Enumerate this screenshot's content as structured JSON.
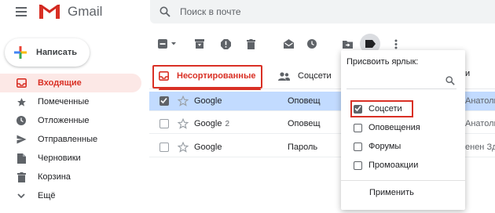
{
  "app": {
    "logo_text": "Gmail"
  },
  "search": {
    "placeholder": "Поиск в почте"
  },
  "compose": {
    "label": "Написать"
  },
  "sidebar": {
    "items": [
      {
        "label": "Входящие",
        "icon": "inbox-icon",
        "active": true
      },
      {
        "label": "Помеченные",
        "icon": "star-icon"
      },
      {
        "label": "Отложенные",
        "icon": "clock-icon"
      },
      {
        "label": "Отправленные",
        "icon": "send-icon"
      },
      {
        "label": "Черновики",
        "icon": "draft-icon"
      },
      {
        "label": "Корзина",
        "icon": "trash-icon"
      },
      {
        "label": "Ещё",
        "icon": "chevron-down-icon"
      }
    ]
  },
  "tabs": [
    {
      "label": "Несортированные",
      "icon": "inbox-icon"
    },
    {
      "label": "Соцсети",
      "icon": "people-icon"
    }
  ],
  "emails": [
    {
      "sender": "Google",
      "count": "",
      "subject": "Оповещ",
      "snippet": "Анатоли",
      "selected": true
    },
    {
      "sender": "Google",
      "count": "2",
      "subject": "Оповещ",
      "snippet": "Анатоли",
      "selected": false
    },
    {
      "sender": "Google",
      "count": "",
      "subject": "Пароль",
      "snippet": "енен Зд",
      "selected": false
    }
  ],
  "label_menu": {
    "title": "Присвоить ярлык:",
    "options": [
      {
        "label": "Соцсети",
        "checked": true
      },
      {
        "label": "Оповещения",
        "checked": false
      },
      {
        "label": "Форумы",
        "checked": false
      },
      {
        "label": "Промоакции",
        "checked": false
      }
    ],
    "apply_label": "Применить",
    "partial_header": "и"
  },
  "colors": {
    "accent": "#d93025",
    "selected_row": "#c2dbff",
    "search_bg": "#f1f3f4"
  }
}
